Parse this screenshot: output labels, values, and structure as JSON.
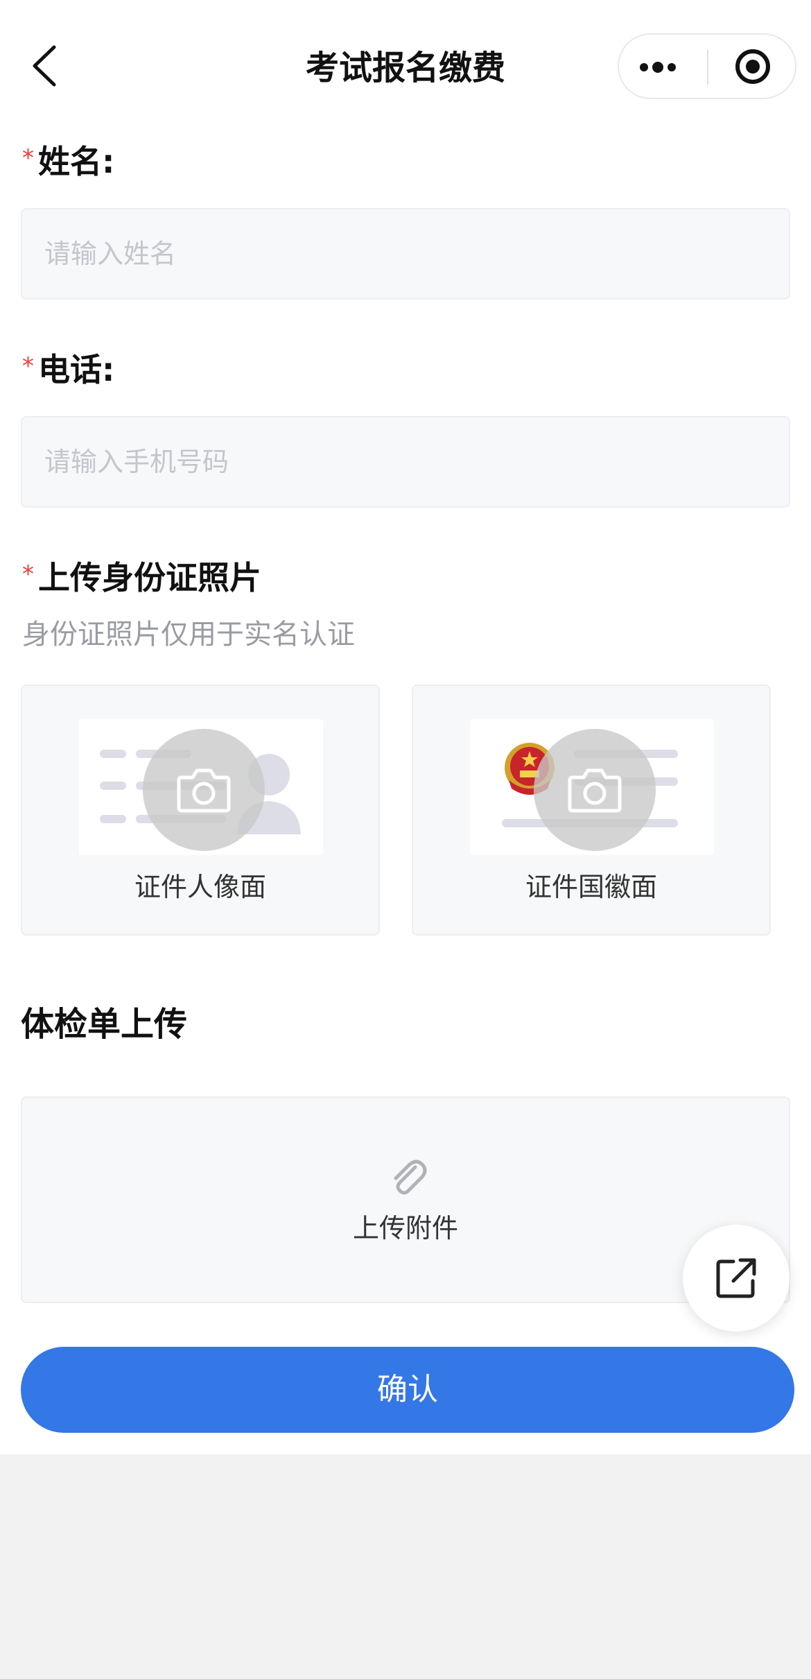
{
  "navbar": {
    "title": "考试报名缴费"
  },
  "form": {
    "name": {
      "required_mark": "*",
      "label": "姓名:",
      "placeholder": "请输入姓名",
      "value": ""
    },
    "phone": {
      "required_mark": "*",
      "label": "电话:",
      "placeholder": "请输入手机号码",
      "value": ""
    },
    "id_upload": {
      "required_mark": "*",
      "label": "上传身份证照片",
      "hint": "身份证照片仅用于实名认证",
      "front_label": "证件人像面",
      "back_label": "证件国徽面"
    },
    "medical_upload": {
      "label": "体检单上传",
      "attach_label": "上传附件"
    }
  },
  "confirm_label": "确认",
  "icons": {
    "back": "chevron-left-icon",
    "more": "more-dots-icon",
    "close": "target-circle-icon",
    "camera": "camera-icon",
    "emblem": "national-emblem-icon",
    "portrait": "person-silhouette-icon",
    "paperclip": "paperclip-icon",
    "share": "external-link-icon"
  },
  "colors": {
    "primary": "#3477e6",
    "required": "#e0443a",
    "placeholder": "#c4c6cc",
    "hint": "#9a9ca2",
    "field_bg": "#f7f8fa"
  }
}
